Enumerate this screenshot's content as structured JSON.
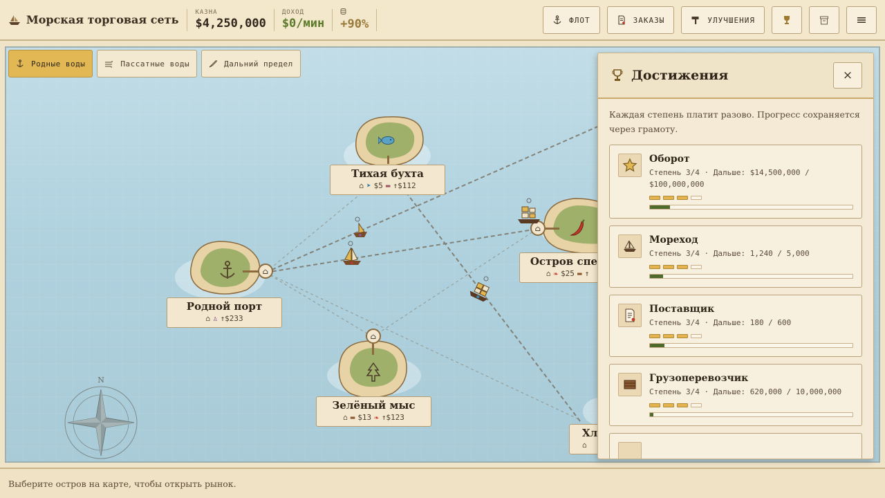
{
  "app": {
    "title": "Морская торговая сеть"
  },
  "stats": [
    {
      "label": "КАЗНА",
      "value": "$4,250,000",
      "tone": "dark"
    },
    {
      "label": "ДОХОД",
      "value": "$0/мин",
      "tone": "green"
    },
    {
      "label": "",
      "value": "+90%",
      "tone": "gold"
    }
  ],
  "actions": {
    "fleet": "ФЛОТ",
    "orders": "ЗАКАЗЫ",
    "upgrades": "УЛУЧШЕНИЯ"
  },
  "regions": [
    {
      "label": "Родные воды",
      "active": true
    },
    {
      "label": "Пассатные воды",
      "active": false
    },
    {
      "label": "Дальний предел",
      "active": false
    }
  ],
  "islands": {
    "home": {
      "name": "Родной порт",
      "price": "↑$233"
    },
    "bay": {
      "name": "Тихая бухта",
      "price1": "$5",
      "price2": "↑$112"
    },
    "spice": {
      "name": "Остров спец",
      "price1": "$25",
      "price2": "↑"
    },
    "green": {
      "name": "Зелёный мыс",
      "price1": "$13",
      "price2": "↑$123"
    },
    "cotton": {
      "name": "Хло"
    }
  },
  "compass": {
    "north": "N"
  },
  "panel": {
    "title": "Достижения",
    "close": "×",
    "description": "Каждая степень платит разово. Прогресс сохраняется через грамоту.",
    "achievements": [
      {
        "name": "Оборот",
        "progress": "Степень 3/4 · Дальше: $14,500,000 / $100,000,000",
        "tiers": 3,
        "fill": 0.1
      },
      {
        "name": "Мореход",
        "progress": "Степень 3/4 · Дальше: 1,240 / 5,000",
        "tiers": 3,
        "fill": 0.065
      },
      {
        "name": "Поставщик",
        "progress": "Степень 3/4 · Дальше: 180 / 600",
        "tiers": 3,
        "fill": 0.072
      },
      {
        "name": "Грузоперевозчик",
        "progress": "Степень 3/4 · Дальше: 620,000 / 10,000,000",
        "tiers": 3,
        "fill": 0.016
      }
    ]
  },
  "footer": {
    "hint": "Выберите остров на карте, чтобы открыть рынок."
  }
}
